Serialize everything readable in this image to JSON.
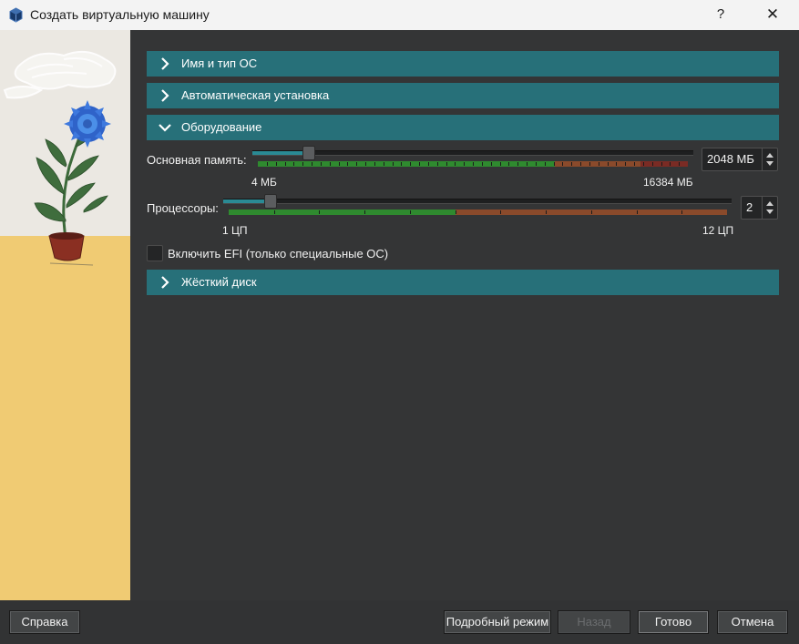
{
  "window": {
    "title": "Создать виртуальную машину",
    "help": "?",
    "close": "✕"
  },
  "sections": {
    "name_os": "Имя и тип ОС",
    "unattended": "Автоматическая установка",
    "hardware": "Оборудование",
    "hard_disk": "Жёсткий диск"
  },
  "hardware": {
    "memory": {
      "label": "Основная память:",
      "value": "2048 МБ",
      "min_label": "4 МБ",
      "max_label": "16384 МБ",
      "level": 0.125
    },
    "cpu": {
      "label": "Процессоры:",
      "value": "2",
      "min_label": "1 ЦП",
      "max_label": "12 ЦП",
      "level": 0.0909
    },
    "efi": {
      "label": "Включить EFI (только специальные ОС)",
      "checked": false
    }
  },
  "buttons": {
    "help": "Справка",
    "expert": "Подробный режим",
    "back": "Назад",
    "finish": "Готово",
    "cancel": "Отмена"
  },
  "colors": {
    "section_header": "#277079",
    "zone_green": "#2f8a2f",
    "zone_orange": "#8a4a2b",
    "zone_red": "#7a2b24",
    "slider_fill": "#2a8a94"
  }
}
